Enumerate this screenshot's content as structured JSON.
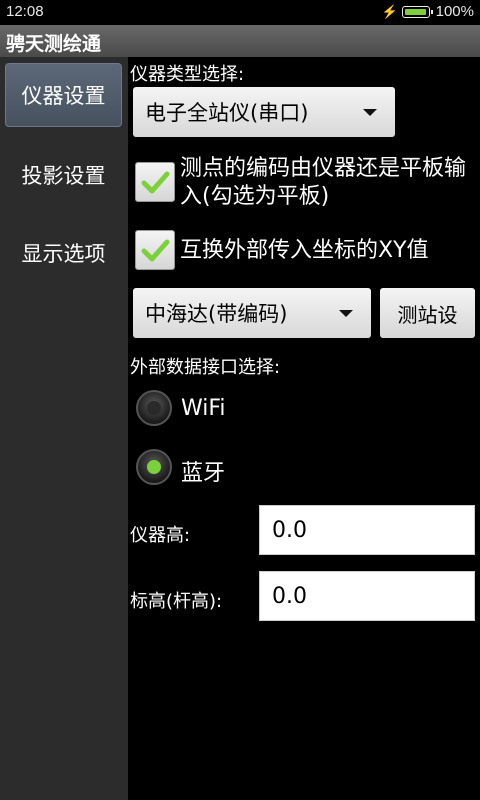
{
  "status": {
    "time": "12:08",
    "battery": "100%",
    "battery_level": 1.0
  },
  "app": {
    "title": "骋天测绘通"
  },
  "sidebar": {
    "items": [
      {
        "label": "仪器设置"
      },
      {
        "label": "投影设置"
      },
      {
        "label": "显示选项"
      }
    ]
  },
  "main": {
    "instrument_type_label": "仪器类型选择:",
    "instrument_type_value": "电子全站仪(串口)",
    "checkbox_code_source": {
      "label": "测点的编码由仪器还是平板输入(勾选为平板)",
      "checked": true
    },
    "checkbox_swap_xy": {
      "label": "互换外部传入坐标的XY值",
      "checked": true
    },
    "brand_value": "中海达(带编码)",
    "station_button": "测站设",
    "interface_label": "外部数据接口选择:",
    "radio_wifi": {
      "label": "WiFi",
      "selected": false
    },
    "radio_bluetooth": {
      "label": "蓝牙",
      "selected": true
    },
    "instrument_height_label": "仪器高:",
    "instrument_height_value": "0.0",
    "target_height_label": "标高(杆高):",
    "target_height_value": "0.0"
  },
  "colors": {
    "accent_check": "#7bd13a",
    "radio_on": "#7bd13a",
    "radio_off": "#2a2a2a"
  }
}
